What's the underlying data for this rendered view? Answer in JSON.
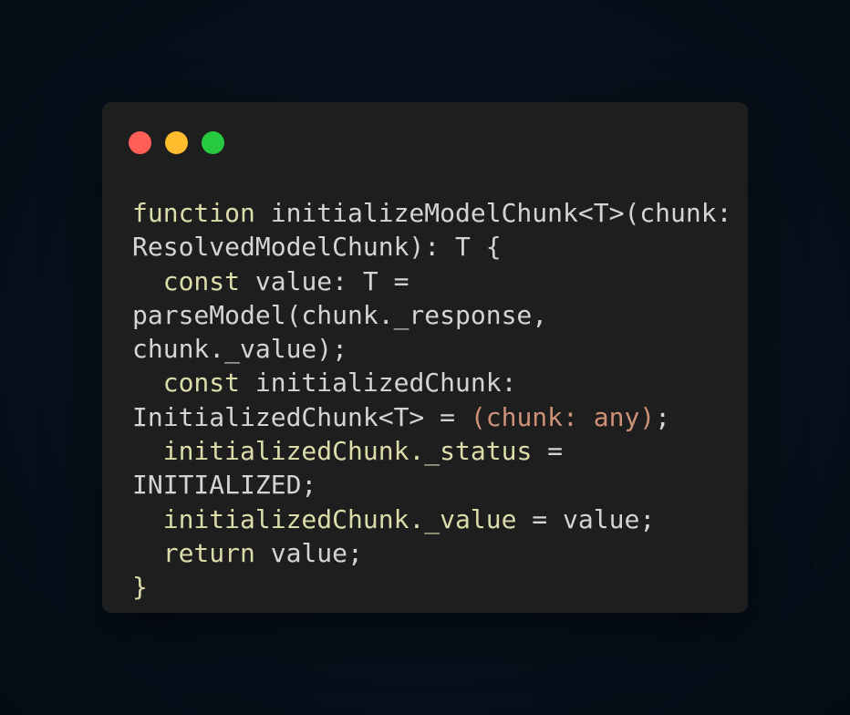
{
  "window": {
    "controls": [
      {
        "name": "close",
        "color": "#ff5f56"
      },
      {
        "name": "minimize",
        "color": "#ffbd2e"
      },
      {
        "name": "maximize",
        "color": "#27c93f"
      }
    ]
  },
  "colors": {
    "keyword": "#dcdcaa",
    "plain": "#d4d4d4",
    "cast": "#ce9178",
    "background": "#1e1e1e"
  },
  "code": {
    "lines": [
      [
        {
          "t": "function",
          "c": "keyword"
        },
        {
          "t": " initializeModelChunk<T>(chunk:",
          "c": "plain"
        }
      ],
      [
        {
          "t": "ResolvedModelChunk): T {",
          "c": "plain"
        }
      ],
      [
        {
          "t": "  ",
          "c": "plain"
        },
        {
          "t": "const",
          "c": "keyword"
        },
        {
          "t": " value: T =",
          "c": "plain"
        }
      ],
      [
        {
          "t": "parseModel(chunk._response,",
          "c": "plain"
        }
      ],
      [
        {
          "t": "chunk._value);",
          "c": "plain"
        }
      ],
      [
        {
          "t": "  ",
          "c": "plain"
        },
        {
          "t": "const",
          "c": "keyword"
        },
        {
          "t": " initializedChunk:",
          "c": "plain"
        }
      ],
      [
        {
          "t": "InitializedChunk<T> = ",
          "c": "plain"
        },
        {
          "t": "(chunk: any)",
          "c": "cast"
        },
        {
          "t": ";",
          "c": "plain"
        }
      ],
      [
        {
          "t": "  ",
          "c": "plain"
        },
        {
          "t": "initializedChunk._status",
          "c": "keyword"
        },
        {
          "t": " =",
          "c": "plain"
        }
      ],
      [
        {
          "t": "INITIALIZED;",
          "c": "plain"
        }
      ],
      [
        {
          "t": "  ",
          "c": "plain"
        },
        {
          "t": "initializedChunk._value",
          "c": "keyword"
        },
        {
          "t": " = value;",
          "c": "plain"
        }
      ],
      [
        {
          "t": "  ",
          "c": "plain"
        },
        {
          "t": "return",
          "c": "keyword"
        },
        {
          "t": " value;",
          "c": "plain"
        }
      ],
      [
        {
          "t": "}",
          "c": "keyword"
        }
      ]
    ]
  }
}
